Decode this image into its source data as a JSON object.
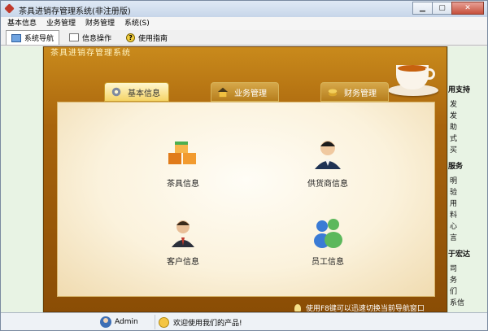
{
  "window": {
    "title": "茶具进销存管理系统(非注册版)",
    "buttons": {
      "minimize": "▁",
      "maximize": "▢",
      "close": "✕"
    }
  },
  "menu": [
    "基本信息",
    "业务管理",
    "财务管理",
    "系统(S)"
  ],
  "toolbar": [
    {
      "label": "系统导航",
      "icon": "navigation-icon"
    },
    {
      "label": "信息操作",
      "icon": "info-icon"
    },
    {
      "label": "使用指南",
      "icon": "help-icon"
    }
  ],
  "header": {
    "title": "茶具进销存管理系统"
  },
  "tabs": [
    {
      "label": "基本信息",
      "active": true,
      "icon": "gear-icon"
    },
    {
      "label": "业务管理",
      "active": false,
      "icon": "house-icon"
    },
    {
      "label": "财务管理",
      "active": false,
      "icon": "coins-icon"
    }
  ],
  "items": [
    {
      "label": "茶具信息",
      "icon": "boxes-icon"
    },
    {
      "label": "供货商信息",
      "icon": "supplier-icon"
    },
    {
      "label": "客户信息",
      "icon": "customer-icon"
    },
    {
      "label": "员工信息",
      "icon": "employees-icon"
    }
  ],
  "hint": "使用F8键可以迅速切换当前导航窗口",
  "right_panel": {
    "lines": [
      "用支持",
      "发",
      "发",
      "助",
      "式",
      "买",
      "服务",
      "明",
      "验",
      "用",
      "料",
      "心",
      "言",
      "于宏达",
      "司",
      "务",
      "们",
      "系信"
    ]
  },
  "status": {
    "user": "Admin",
    "welcome": "欢迎使用我们的产品!"
  },
  "colors": {
    "accent": "#a8640c",
    "tab_active": "#f5d466",
    "panel": "#e8f3e4"
  }
}
